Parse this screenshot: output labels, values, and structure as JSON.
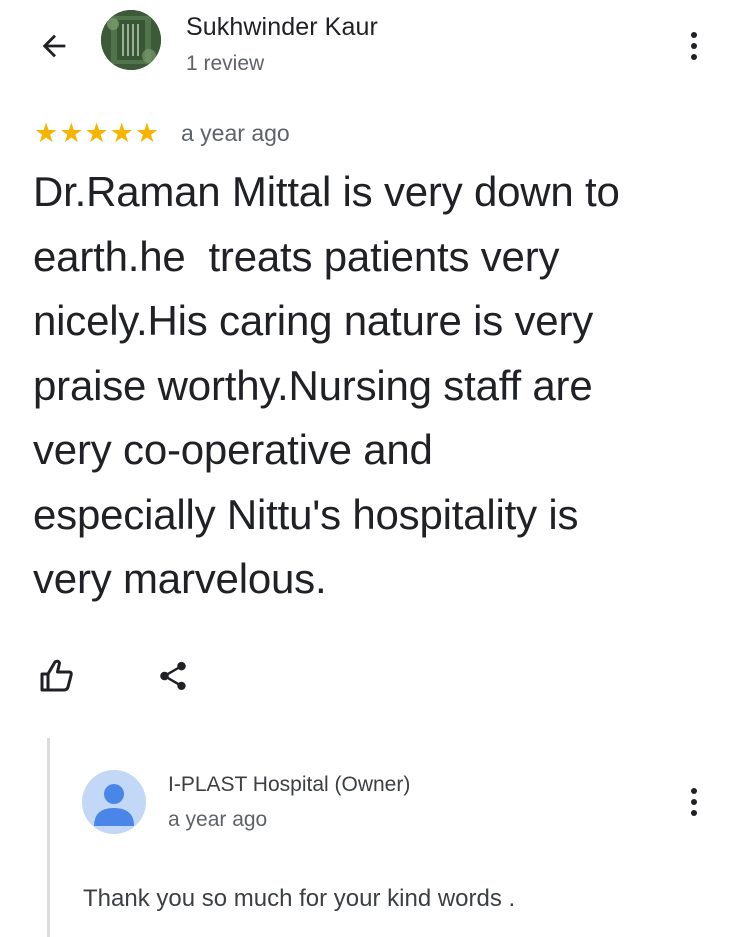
{
  "review": {
    "author_name": "Sukhwinder Kaur",
    "author_meta": "1 review",
    "rating": 5,
    "stars": [
      "★",
      "★",
      "★",
      "★",
      "★"
    ],
    "time": "a year ago",
    "text": "Dr.Raman Mittal is very down to\nearth.he  treats patients very\nnicely.His caring nature is very\npraise worthy.Nursing staff are\nvery co-operative and\nespecially Nittu's hospitality is\nvery marvelous."
  },
  "owner_reply": {
    "name": "I-PLAST Hospital (Owner)",
    "time": "a year ago",
    "text": "Thank you so much for your kind words ."
  },
  "icons": {
    "back": "arrow-back-icon",
    "more": "more-vertical-icon",
    "like": "thumb-up-icon",
    "share": "share-icon",
    "owner_avatar": "person-icon"
  },
  "colors": {
    "star": "#f6b400",
    "owner_avatar_bg": "#c3d7f7",
    "owner_avatar_fg": "#4a86e8",
    "secondary_text": "#5f6368"
  }
}
